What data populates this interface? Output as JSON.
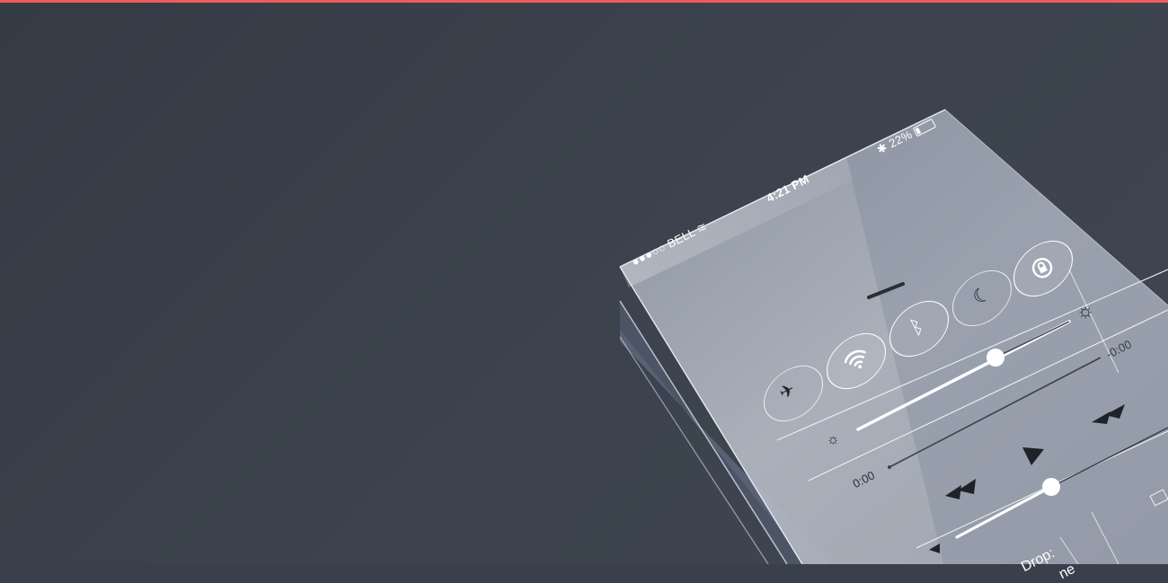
{
  "status_bar": {
    "carrier": "BELL",
    "time": "4:21 PM",
    "battery": "22%"
  },
  "controls": {
    "airplane_icon": "airplane-icon",
    "wifi_icon": "wifi-icon",
    "bluetooth_icon": "bluetooth-icon",
    "do_not_disturb_icon": "moon-icon",
    "rotation_lock_icon": "rotation-lock-icon"
  },
  "brightness": {
    "level": 0.72
  },
  "media": {
    "elapsed": "0:00",
    "remaining": "-0:00",
    "volume": 0.55
  },
  "airdrop": {
    "label": "Drop:",
    "label_tail": "ne"
  },
  "colors": {
    "accent_bar": "#f05a5b",
    "background": "#3a404b"
  }
}
